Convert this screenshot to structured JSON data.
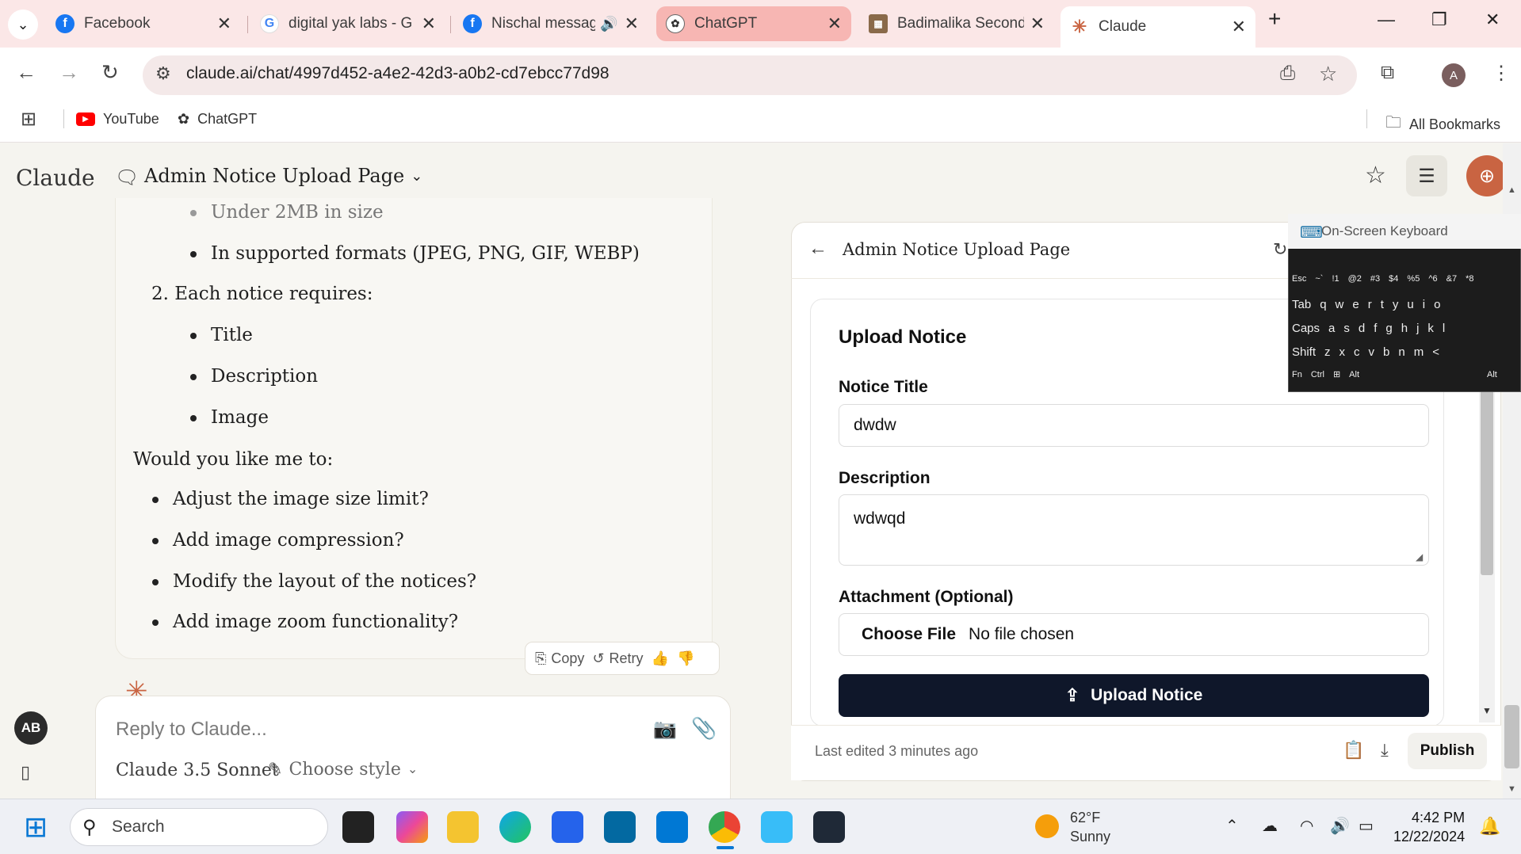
{
  "browser": {
    "tabs": [
      {
        "title": "Facebook",
        "icon": "facebook-icon"
      },
      {
        "title": "digital yak labs - G",
        "icon": "google-icon"
      },
      {
        "title": "Nischal messag",
        "icon": "facebook-icon"
      },
      {
        "title": "ChatGPT",
        "icon": "chatgpt-icon"
      },
      {
        "title": "Badimalika Second",
        "icon": "site-icon"
      },
      {
        "title": "Claude",
        "icon": "claude-icon"
      }
    ],
    "url": "claude.ai/chat/4997d452-a4e2-42d3-a0b2-cd7ebcc77d98",
    "profile_initial": "A",
    "bookmarks": [
      {
        "label": "YouTube"
      },
      {
        "label": "ChatGPT"
      }
    ],
    "all_bookmarks": "All Bookmarks"
  },
  "app": {
    "logo": "Claude",
    "conversation_title": "Admin Notice Upload Page",
    "avatar": "AB"
  },
  "message": {
    "partial_item": "Under 2MB in size",
    "formats_item": "In supported formats (JPEG, PNG, GIF, WEBP)",
    "numbered": "2. Each notice requires:",
    "requirements": [
      "Title",
      "Description",
      "Image"
    ],
    "question": "Would you like me to:",
    "options": [
      "Adjust the image size limit?",
      "Add image compression?",
      "Modify the layout of the notices?",
      "Add image zoom functionality?"
    ],
    "copy": "Copy",
    "retry": "Retry"
  },
  "reply": {
    "placeholder": "Reply to Claude...",
    "model": "Claude 3.5 Sonnet",
    "style": "Choose style"
  },
  "artifact": {
    "title": "Admin Notice Upload Page",
    "form_heading": "Upload Notice",
    "notice_title_label": "Notice Title",
    "notice_title_value": "dwdw",
    "description_label": "Description",
    "description_value": "wdwqd",
    "attachment_label": "Attachment (Optional)",
    "choose_file": "Choose File",
    "no_file": "No file chosen",
    "upload_button": "Upload Notice",
    "last_edited": "Last edited 3 minutes ago",
    "publish": "Publish"
  },
  "osk": {
    "title": "On-Screen Keyboard",
    "rows": [
      [
        "Esc",
        "~`",
        "!1",
        "@2",
        "#3",
        "$4",
        "%5",
        "^6",
        "&7",
        "*8"
      ],
      [
        "Tab",
        "q",
        "w",
        "e",
        "r",
        "t",
        "y",
        "u",
        "i",
        "o"
      ],
      [
        "Caps",
        "a",
        "s",
        "d",
        "f",
        "g",
        "h",
        "j",
        "k",
        "l"
      ],
      [
        "Shift",
        "z",
        "x",
        "c",
        "v",
        "b",
        "n",
        "m",
        "<"
      ],
      [
        "Fn",
        "Ctrl",
        "Alt",
        "Alt"
      ]
    ]
  },
  "taskbar": {
    "search": "Search",
    "temp": "62°F",
    "condition": "Sunny",
    "time": "4:42 PM",
    "date": "12/22/2024"
  },
  "colors": {
    "tab_strip": "#fbe7e7",
    "selected_tab": "#f7b6b3",
    "claude_accent": "#c96442",
    "upload_button": "#0f172a"
  }
}
